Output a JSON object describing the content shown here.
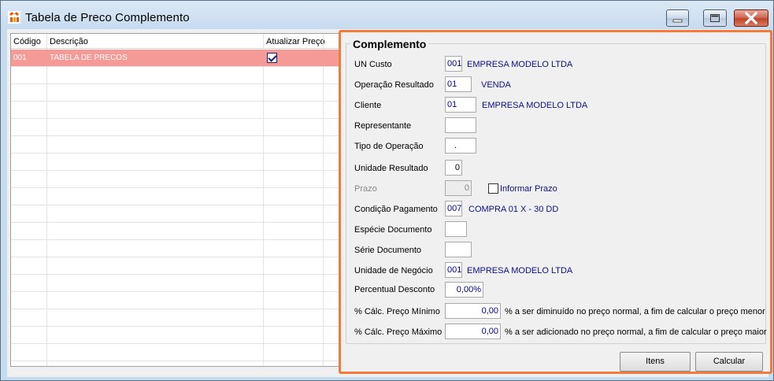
{
  "window": {
    "title": "Tabela de Preco Complemento",
    "accent_border": "#f27a3a",
    "selected_row_color": "#f59a96",
    "minimize_icon": "minimize-icon",
    "maximize_icon": "maximize-icon",
    "close_icon": "close-icon"
  },
  "grid": {
    "columns": [
      "Código",
      "Descrição",
      "Atualizar Preço"
    ],
    "rows": [
      {
        "codigo": "001",
        "descricao": "TABELA DE PRECOS",
        "atualizar": true
      }
    ]
  },
  "complemento": {
    "title": "Complemento",
    "un_custo": {
      "label": "UN Custo",
      "code": "001",
      "desc": "EMPRESA MODELO LTDA"
    },
    "operacao_resultado": {
      "label": "Operação Resultado",
      "code": "01",
      "desc": "VENDA"
    },
    "cliente": {
      "label": "Cliente",
      "code": "01",
      "desc": "EMPRESA MODELO LTDA"
    },
    "representante": {
      "label": "Representante",
      "code": ""
    },
    "tipo_operacao": {
      "label": "Tipo de Operação",
      "code": "."
    },
    "unidade_resultado": {
      "label": "Unidade Resultado",
      "code": "0"
    },
    "prazo": {
      "label": "Prazo",
      "value": "0",
      "checkbox_label": "Informar Prazo"
    },
    "condicao_pagamento": {
      "label": "Condição Pagamento",
      "code": "007",
      "desc": "COMPRA 01 X - 30 DD"
    },
    "especie_documento": {
      "label": "Espécie Documento",
      "code": ""
    },
    "serie_documento": {
      "label": "Série Documento",
      "code": ""
    },
    "unidade_negocio": {
      "label": "Unidade de Negócio",
      "code": "001",
      "desc": "EMPRESA MODELO LTDA"
    },
    "percentual_desconto": {
      "label": "Percentual Desconto",
      "value": "0,00%"
    },
    "preco_minimo": {
      "label": "% Cálc. Preço Mínimo",
      "value": "0,00",
      "note": "% a ser diminuído no preço normal, a fim de calcular o preço menor"
    },
    "preco_maximo": {
      "label": "% Cálc. Preço Máximo",
      "value": "0,00",
      "note": "% a ser adicionado no preço normal, a fim de calcular o preço maior"
    }
  },
  "buttons": {
    "itens": "Itens",
    "calcular": "Calcular"
  }
}
